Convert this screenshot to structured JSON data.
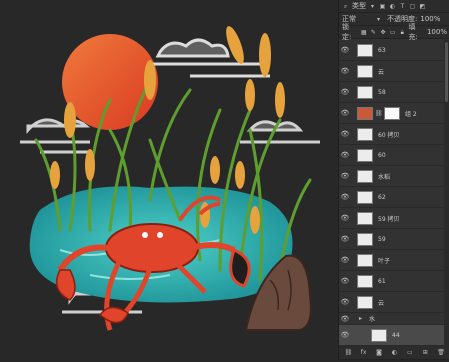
{
  "panel": {
    "filter_label": "类型",
    "blend_mode": "正常",
    "opacity_label": "不透明度:",
    "opacity_value": "100%",
    "lock_label": "锁定:",
    "fill_label": "填充:",
    "fill_value": "100%"
  },
  "layers": [
    {
      "name": "63"
    },
    {
      "name": "云"
    },
    {
      "name": "58"
    },
    {
      "name": "组 2"
    },
    {
      "name": "60 拷贝"
    },
    {
      "name": "60"
    },
    {
      "name": "水稻"
    },
    {
      "name": "62"
    },
    {
      "name": "59 拷贝"
    },
    {
      "name": "59"
    },
    {
      "name": "叶子"
    },
    {
      "name": "61"
    },
    {
      "name": "云"
    },
    {
      "name": "水"
    },
    {
      "name": "44"
    }
  ],
  "colors": {
    "canvas_bg": "#282828",
    "sun": "#e8552a",
    "water": "#2fb3b0",
    "crab": "#e0452b",
    "grass": "#5e9e2e",
    "wheat": "#e6a23c",
    "cloud": "#d9d9d9",
    "rock": "#6b4a3e"
  }
}
